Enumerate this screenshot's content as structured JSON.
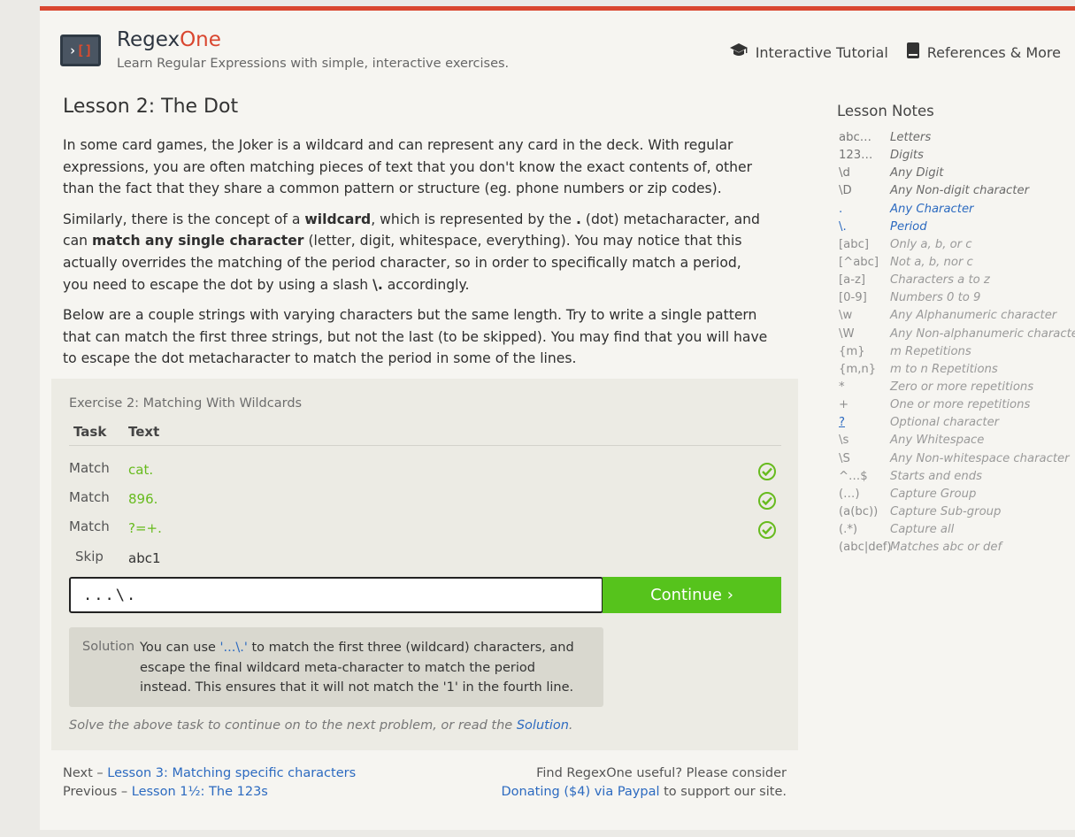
{
  "header": {
    "logo_chev": "›",
    "logo_brk": "[]",
    "brand_main": "Regex",
    "brand_accent": "One",
    "tagline": "Learn Regular Expressions with simple, interactive exercises.",
    "nav": [
      {
        "label": "Interactive Tutorial",
        "icon": "graduation-cap-icon"
      },
      {
        "label": "References & More",
        "icon": "book-icon"
      }
    ]
  },
  "lesson": {
    "title": "Lesson 2: The Dot",
    "p1": "In some card games, the Joker is a wildcard and can represent any card in the deck. With regular expressions, you are often matching pieces of text that you don't know the exact contents of, other than the fact that they share a common pattern or structure (eg. phone numbers or zip codes).",
    "p2_a": "Similarly, there is the concept of a ",
    "p2_b": "wildcard",
    "p2_c": ", which is represented by the ",
    "p2_d": ".",
    "p2_e": " (dot) metacharacter, and can ",
    "p2_f": "match any single character",
    "p2_g": " (letter, digit, whitespace, everything). You may notice that this actually overrides the matching of the period character, so in order to specifically match a period, you need to escape the dot by using a slash ",
    "p2_h": "\\.",
    "p2_i": " accordingly.",
    "p3": "Below are a couple strings with varying characters but the same length. Try to write a single pattern that can match the first three strings, but not the last (to be skipped). You may find that you will have to escape the dot metacharacter to match the period in some of the lines."
  },
  "exercise": {
    "title": "Exercise 2: Matching With Wildcards",
    "col_task": "Task",
    "col_text": "Text",
    "rows": [
      {
        "task": "Match",
        "text": "cat."
      },
      {
        "task": "Match",
        "text": "896."
      },
      {
        "task": "Match",
        "text": "?=+."
      },
      {
        "task": "Skip",
        "text": "abc1"
      }
    ],
    "input_value": "...\\.",
    "continue_label": "Continue ›",
    "solution_label": "Solution",
    "solution_a": "You can use ",
    "solution_code": "'...\\.'",
    "solution_b": " to match the first three (wildcard) characters, and escape the final wildcard meta-character to match the period instead. This ensures that it will not match the '1' in the fourth line.",
    "hint_a": "Solve the above task to continue on to the next problem, or read the ",
    "hint_link": "Solution",
    "hint_b": "."
  },
  "footer": {
    "next_prefix": "Next – ",
    "next_link": "Lesson 3: Matching specific characters",
    "prev_prefix": "Previous – ",
    "prev_link": "Lesson 1½: The 123s",
    "useful": "Find RegexOne useful? Please consider",
    "donate_link": "Donating ($4) via Paypal",
    "donate_suffix": " to support our site."
  },
  "notes": {
    "title": "Lesson Notes",
    "items": [
      {
        "k": "abc…",
        "d": "Letters"
      },
      {
        "k": "123…",
        "d": "Digits"
      },
      {
        "k": "\\d",
        "d": "Any Digit"
      },
      {
        "k": "\\D",
        "d": "Any Non-digit character"
      },
      {
        "k": ".",
        "d": "Any Character"
      },
      {
        "k": "\\.",
        "d": "Period"
      },
      {
        "k": "[abc]",
        "d": "Only a, b, or c"
      },
      {
        "k": "[^abc]",
        "d": "Not a, b, nor c"
      },
      {
        "k": "[a-z]",
        "d": "Characters a to z"
      },
      {
        "k": "[0-9]",
        "d": "Numbers 0 to 9"
      },
      {
        "k": "\\w",
        "d": "Any Alphanumeric character"
      },
      {
        "k": "\\W",
        "d": "Any Non-alphanumeric character"
      },
      {
        "k": "{m}",
        "d": "m Repetitions"
      },
      {
        "k": "{m,n}",
        "d": "m to n Repetitions"
      },
      {
        "k": "*",
        "d": "Zero or more repetitions"
      },
      {
        "k": "+",
        "d": "One or more repetitions"
      },
      {
        "k": "?",
        "d": "Optional character"
      },
      {
        "k": "\\s",
        "d": "Any Whitespace"
      },
      {
        "k": "\\S",
        "d": "Any Non-whitespace character"
      },
      {
        "k": "^…$",
        "d": "Starts and ends"
      },
      {
        "k": "(…)",
        "d": "Capture Group"
      },
      {
        "k": "(a(bc))",
        "d": "Capture Sub-group"
      },
      {
        "k": "(.*)",
        "d": "Capture all"
      },
      {
        "k": "(abc|def)",
        "d": "Matches abc or def"
      }
    ]
  },
  "colors": {
    "accent": "#d9462f",
    "match_green": "#67bb1e",
    "continue_green": "#56c31c",
    "link_blue": "#2c6ac0"
  }
}
